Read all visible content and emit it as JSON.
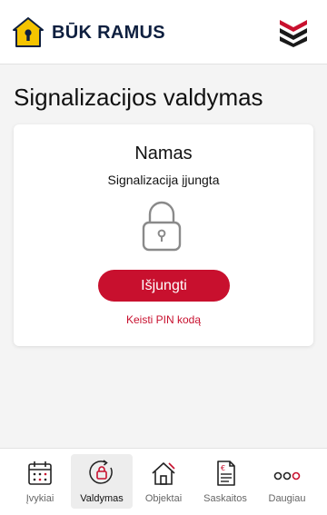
{
  "brand": {
    "name": "BŪK RAMUS"
  },
  "page": {
    "title": "Signalizacijos valdymas"
  },
  "card": {
    "object_name": "Namas",
    "status": "Signalizacija įjungta",
    "action_button": "Išjungti",
    "change_pin_link": "Keisti PIN kodą"
  },
  "nav": {
    "items": [
      {
        "label": "Įvykiai",
        "icon": "calendar-icon",
        "active": false
      },
      {
        "label": "Valdymas",
        "icon": "lock-control-icon",
        "active": true
      },
      {
        "label": "Objektai",
        "icon": "house-icon",
        "active": false
      },
      {
        "label": "Saskaitos",
        "icon": "invoice-icon",
        "active": false
      },
      {
        "label": "Daugiau",
        "icon": "more-dots-icon",
        "active": false
      }
    ]
  },
  "colors": {
    "accent": "#c8102e",
    "brand_navy": "#0e1f3f",
    "logo_yellow": "#f5c400",
    "background": "#f4f4f4"
  }
}
